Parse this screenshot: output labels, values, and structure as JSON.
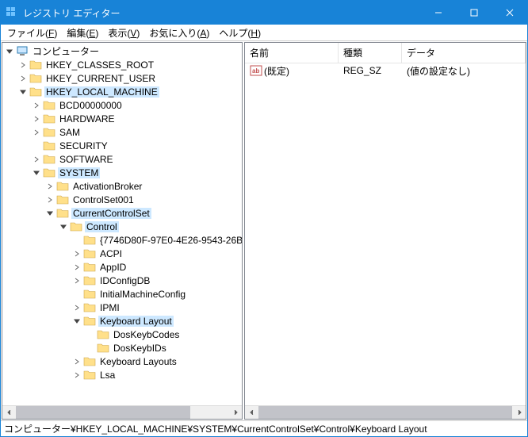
{
  "window": {
    "title": "レジストリ エディター"
  },
  "menu": {
    "file": "ファイル(<u>F</u>)",
    "edit": "編集(<u>E</u>)",
    "view": "表示(<u>V</u>)",
    "fav": "お気に入り(<u>A</u>)",
    "help": "ヘルプ(<u>H</u>)"
  },
  "tree": {
    "root": "コンピューター",
    "items": [
      {
        "indent": 1,
        "tw": "right",
        "label": "HKEY_CLASSES_ROOT"
      },
      {
        "indent": 1,
        "tw": "right",
        "label": "HKEY_CURRENT_USER"
      },
      {
        "indent": 1,
        "tw": "down",
        "label": "HKEY_LOCAL_MACHINE",
        "hl": true
      },
      {
        "indent": 2,
        "tw": "right",
        "label": "BCD00000000"
      },
      {
        "indent": 2,
        "tw": "right",
        "label": "HARDWARE"
      },
      {
        "indent": 2,
        "tw": "right",
        "label": "SAM"
      },
      {
        "indent": 2,
        "tw": "none",
        "label": "SECURITY"
      },
      {
        "indent": 2,
        "tw": "right",
        "label": "SOFTWARE"
      },
      {
        "indent": 2,
        "tw": "down",
        "label": "SYSTEM",
        "hl": true
      },
      {
        "indent": 3,
        "tw": "right",
        "label": "ActivationBroker"
      },
      {
        "indent": 3,
        "tw": "right",
        "label": "ControlSet001"
      },
      {
        "indent": 3,
        "tw": "down",
        "label": "CurrentControlSet",
        "hl": true
      },
      {
        "indent": 4,
        "tw": "down",
        "label": "Control",
        "hl": true
      },
      {
        "indent": 5,
        "tw": "none",
        "label": "{7746D80F-97E0-4E26-9543-26B"
      },
      {
        "indent": 5,
        "tw": "right",
        "label": "ACPI"
      },
      {
        "indent": 5,
        "tw": "right",
        "label": "AppID"
      },
      {
        "indent": 5,
        "tw": "right",
        "label": "IDConfigDB"
      },
      {
        "indent": 5,
        "tw": "none",
        "label": "InitialMachineConfig"
      },
      {
        "indent": 5,
        "tw": "right",
        "label": "IPMI"
      },
      {
        "indent": 5,
        "tw": "down",
        "label": "Keyboard Layout",
        "hl": true
      },
      {
        "indent": 6,
        "tw": "none",
        "label": "DosKeybCodes"
      },
      {
        "indent": 6,
        "tw": "none",
        "label": "DosKeybIDs"
      },
      {
        "indent": 5,
        "tw": "right",
        "label": "Keyboard Layouts"
      },
      {
        "indent": 5,
        "tw": "right",
        "label": "Lsa"
      }
    ]
  },
  "list": {
    "columns": {
      "name": "名前",
      "type": "種類",
      "data": "データ"
    },
    "rows": [
      {
        "name": "(既定)",
        "type": "REG_SZ",
        "data": "(値の設定なし)"
      }
    ]
  },
  "status": "コンピューター¥HKEY_LOCAL_MACHINE¥SYSTEM¥CurrentControlSet¥Control¥Keyboard Layout"
}
